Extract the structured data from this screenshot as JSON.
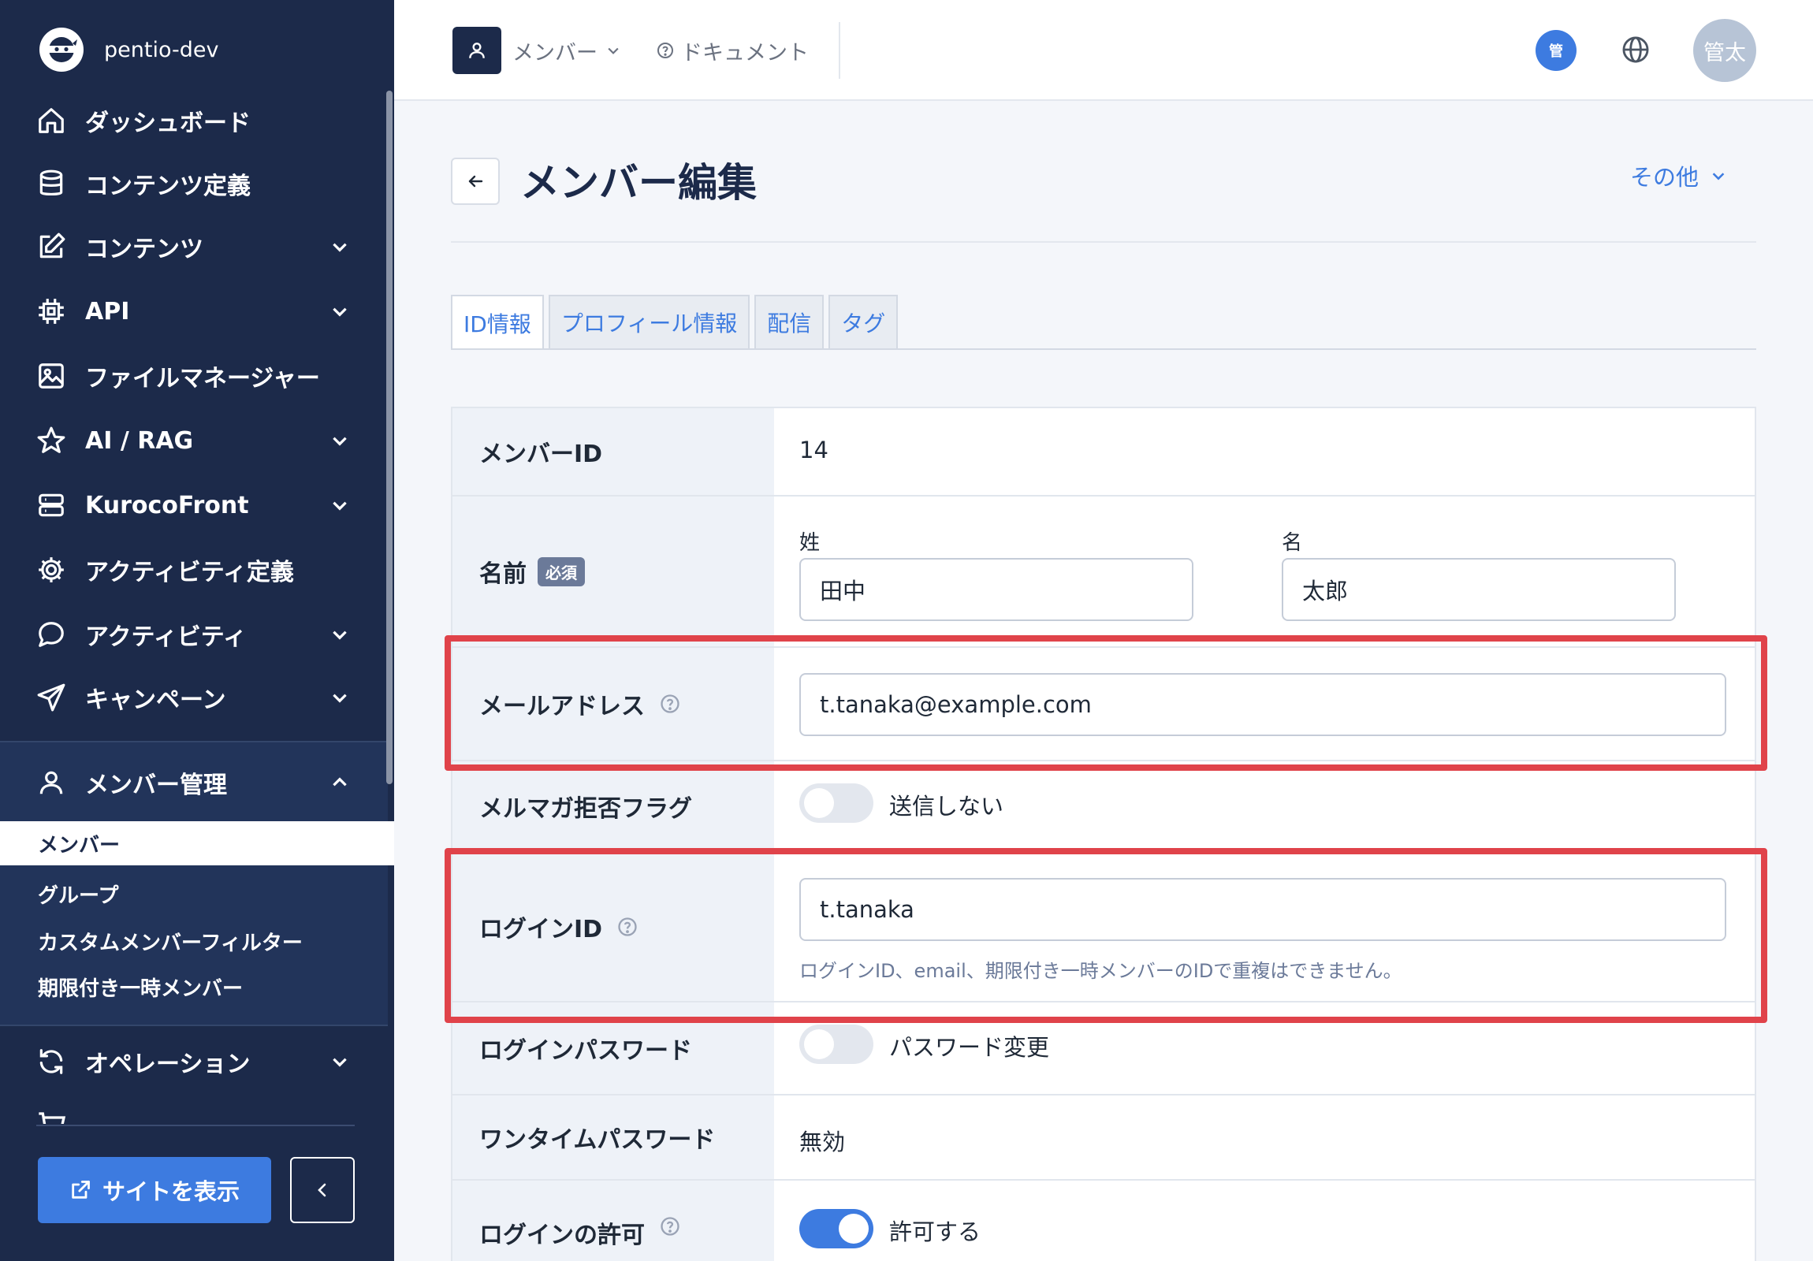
{
  "colors": {
    "sidebar_bg": "#1c2a4a",
    "accent": "#3d7be0",
    "highlight": "#e0434a"
  },
  "sidebar": {
    "org_name": "pentio-dev",
    "items": [
      {
        "label": "ダッシュボード",
        "icon": "home-icon",
        "has_chevron": false
      },
      {
        "label": "コンテンツ定義",
        "icon": "database-icon",
        "has_chevron": false
      },
      {
        "label": "コンテンツ",
        "icon": "edit-icon",
        "has_chevron": true
      },
      {
        "label": "API",
        "icon": "chip-icon",
        "has_chevron": true
      },
      {
        "label": "ファイルマネージャー",
        "icon": "image-icon",
        "has_chevron": false
      },
      {
        "label": "AI / RAG",
        "icon": "star-icon",
        "has_chevron": true
      },
      {
        "label": "KurocoFront",
        "icon": "server-icon",
        "has_chevron": true
      },
      {
        "label": "アクティビティ定義",
        "icon": "gear-icon",
        "has_chevron": false
      },
      {
        "label": "アクティビティ",
        "icon": "chat-icon",
        "has_chevron": true
      },
      {
        "label": "キャンペーン",
        "icon": "send-icon",
        "has_chevron": true
      }
    ],
    "member_group": {
      "label": "メンバー管理",
      "icon": "user-icon",
      "children": [
        "メンバー",
        "グループ",
        "カスタムメンバーフィルター",
        "期限付き一時メンバー"
      ],
      "active_index": 0
    },
    "after_items": [
      {
        "label": "オペレーション",
        "icon": "sync-icon",
        "has_chevron": true
      }
    ],
    "site_button": "サイトを表示"
  },
  "topbar": {
    "member_menu": "メンバー",
    "docs": "ドキュメント",
    "role_badge": "管",
    "avatar": "管太"
  },
  "page": {
    "title": "メンバー編集",
    "other_menu": "その他",
    "tabs": [
      "ID情報",
      "プロフィール情報",
      "配信",
      "タグ"
    ],
    "active_tab": 0
  },
  "form": {
    "member_id": {
      "label": "メンバーID",
      "value": "14"
    },
    "name": {
      "label": "名前",
      "required_badge": "必須",
      "last_label": "姓",
      "last_value": "田中",
      "first_label": "名",
      "first_value": "太郎"
    },
    "email": {
      "label": "メールアドレス",
      "value": "t.tanaka@example.com"
    },
    "newsletter": {
      "label": "メルマガ拒否フラグ",
      "toggle_label": "送信しない",
      "enabled": false
    },
    "login_id": {
      "label": "ログインID",
      "value": "t.tanaka",
      "note": "ログインID、email、期限付き一時メンバーのIDで重複はできません。"
    },
    "password": {
      "label": "ログインパスワード",
      "toggle_label": "パスワード変更",
      "enabled": false
    },
    "otp": {
      "label": "ワンタイムパスワード",
      "value": "無効"
    },
    "login_allowed": {
      "label": "ログインの許可",
      "toggle_label": "許可する",
      "enabled": true
    }
  }
}
